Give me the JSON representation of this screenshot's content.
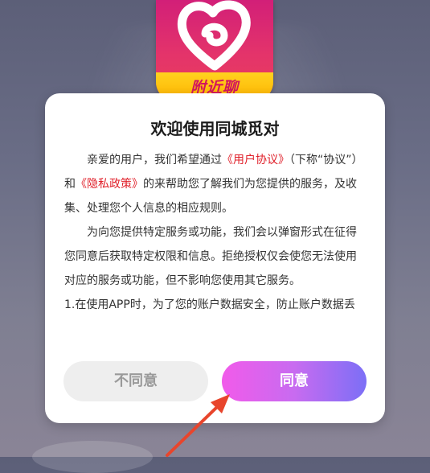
{
  "app": {
    "logo_text": "附近聊"
  },
  "dialog": {
    "title": "欢迎使用同城觅对",
    "paragraph1": {
      "text_a": "亲爱的用户，我们希望通过",
      "link_user_agreement": "《用户协议》",
      "text_b": "（下称“协议”）和",
      "link_privacy": "《隐私政策》",
      "text_c": "的来帮助您了解我们为您提供的服务，及收集、处理您个人信息的相应规则。"
    },
    "paragraph2": "为向您提供特定服务或功能，我们会以弹窗形式在征得您同意后获取特定权限和信息。拒绝授权仅会使您无法使用对应的服务或功能，但不影响您使用其它服务。",
    "paragraph3": "1.在使用APP时，为了您的账户数据安全，防止账户数据丢"
  },
  "buttons": {
    "disagree": "不同意",
    "agree": "同意"
  },
  "colors": {
    "link": "#e0202a",
    "agree_gradient_start": "#f15bea",
    "agree_gradient_end": "#7c6ff6",
    "annotation_arrow": "#e8452c"
  }
}
